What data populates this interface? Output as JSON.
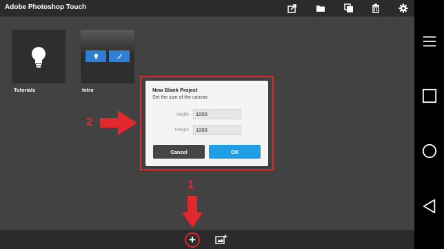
{
  "app": {
    "title": "Adobe Photoshop Touch"
  },
  "toolbar": {
    "icons": [
      "share-icon",
      "folder-icon",
      "duplicate-icon",
      "trash-icon",
      "gear-icon"
    ]
  },
  "projects": [
    {
      "label": "Tutorials",
      "icon": "lightbulb-icon"
    },
    {
      "label": "Intro",
      "icon": "project-preview"
    }
  ],
  "dialog": {
    "title": "New Blank Project",
    "subtitle": "Set the size of the canvas",
    "width_label": "Width",
    "width_value": "1000",
    "height_label": "Height",
    "height_value": "1000",
    "cancel_label": "Cancel",
    "ok_label": "OK"
  },
  "annotations": {
    "step1": "1",
    "step2": "2",
    "color": "#e0282d"
  },
  "bottombar": {
    "plus_label": "+",
    "icons": [
      "add-icon",
      "add-image-icon"
    ]
  },
  "navbar": {
    "icons": [
      "menu-icon",
      "recent-apps-icon",
      "home-icon",
      "back-icon"
    ]
  },
  "colors": {
    "accent": "#1f9ee5",
    "background": "#424242",
    "bar": "#2b2b2b"
  }
}
